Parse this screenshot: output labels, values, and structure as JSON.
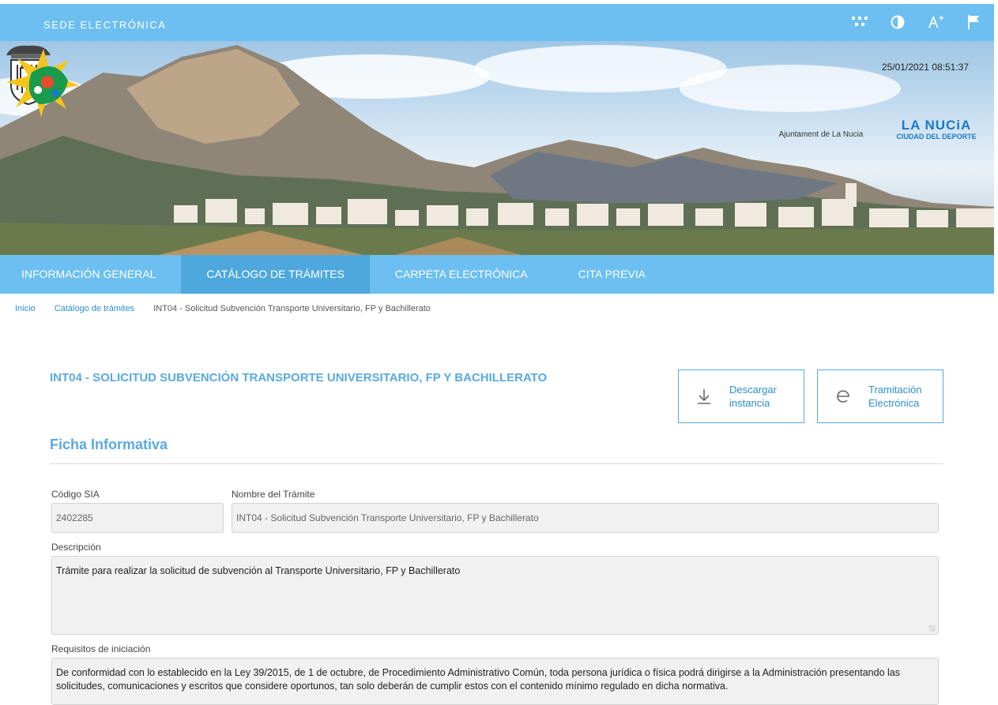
{
  "header": {
    "brand": "SEDE ELECTRÓNICA"
  },
  "tools": [
    {
      "icon": "grid-icon"
    },
    {
      "icon": "contrast-icon"
    },
    {
      "icon": "font-size-icon"
    },
    {
      "icon": "flag-icon"
    }
  ],
  "hero": {
    "datetime": "25/01/2021 08:51:37",
    "crest_label": "Ajuntament de La Nucia",
    "logo_title": "LA NUCiA",
    "logo_subtitle": "CIUDAD DEL DEPORTE"
  },
  "nav": [
    {
      "label": "INFORMACIÓN GENERAL",
      "active": false
    },
    {
      "label": "CATÁLOGO DE TRÁMITES",
      "active": true
    },
    {
      "label": "CARPETA ELECTRÓNICA",
      "active": false
    },
    {
      "label": "CITA PREVIA",
      "active": false
    }
  ],
  "breadcrumb": {
    "home": "Inicio",
    "catalog": "Catálogo de trámites",
    "current": "INT04 - Solicitud Subvención Transporte Universitario, FP y Bachillerato"
  },
  "procedure": {
    "title": "INT04 - SOLICITUD SUBVENCIÓN TRANSPORTE UNIVERSITARIO, FP Y BACHILLERATO",
    "download_label_1": "Descargar",
    "download_label_2": "instancia",
    "online_label_1": "Tramitación",
    "online_label_2": "Electrónica"
  },
  "ficha": {
    "section_title": "Ficha Informativa",
    "sia_label": "Código SIA",
    "sia_value": "2402285",
    "name_label": "Nombre del Trámite",
    "name_value": "INT04 - Solicitud Subvención Transporte Universitario, FP y Bachillerato",
    "desc_label": "Descripción",
    "desc_value": "Trámite para realizar la solicitud de subvención al Transporte Universitario, FP y Bachillerato",
    "req_label": "Requisitos de iniciación",
    "req_value": "De conformidad con lo establecido en la Ley 39/2015, de 1 de octubre, de Procedimiento Administrativo Común, toda persona jurídica o física podrá dirigirse a la Administración presentando las solicitudes, comunicaciones y escritos que considere oportunos, tan solo deberán de cumplir estos con el contenido mínimo regulado en dicha normativa."
  },
  "colors": {
    "primary": "#6cbff0",
    "active": "#4ea8dd",
    "title": "#5aa9e0",
    "link": "#2b8fd1"
  }
}
